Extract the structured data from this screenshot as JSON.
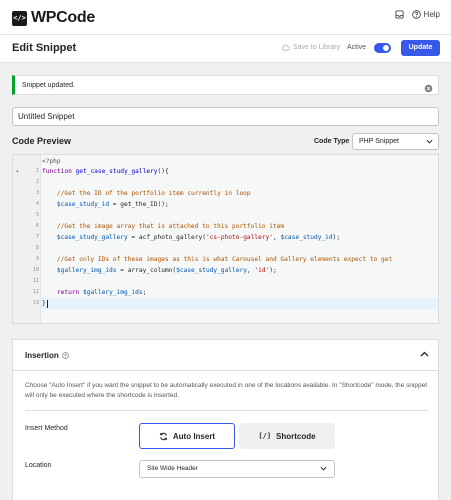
{
  "app": {
    "logo_mark": "</>",
    "logo_text": "WPCode",
    "help_label": "Help"
  },
  "header": {
    "title": "Edit Snippet",
    "save_to_library": "Save to Library",
    "active_label": "Active",
    "active": true,
    "update_label": "Update"
  },
  "notice": {
    "text": "Snippet updated."
  },
  "snippet": {
    "title_value": "Untitled Snippet"
  },
  "code_preview": {
    "title": "Code Preview",
    "code_type_label": "Code Type",
    "code_type_value": "PHP Snippet",
    "line_numbers": [
      "1",
      "2",
      "3",
      "4",
      "5",
      "6",
      "7",
      "8",
      "9",
      "10",
      "11",
      "12",
      "13"
    ],
    "header_line": "<?php",
    "lines": [
      "function get_case_study_gallery(){",
      "",
      "    //Get the ID of the portfolio item currently in loop",
      "    $case_study_id = get_the_ID();",
      "",
      "    //Get the image array that is attached to this portfolio item",
      "    $case_study_gallery = acf_photo_gallery('cs-photo-gallery', $case_study_id);",
      "",
      "    //Get only IDs of these images as this is what Carousel and Gallery elements expect to get",
      "    $gallery_img_ids = array_column($case_study_gallery, 'id');",
      "",
      "    return $gallery_img_ids;",
      "}"
    ]
  },
  "insertion": {
    "title": "Insertion",
    "description": "Choose \"Auto Insert\" if you want the snippet to be automatically executed in one of the locations available. In \"Shortcode\" mode, the snippet will only be executed where the shortcode is inserted.",
    "insert_method_label": "Insert Method",
    "auto_insert_label": "Auto Insert",
    "shortcode_glyph": "[/]",
    "shortcode_label": "Shortcode",
    "location_label": "Location",
    "location_value": "Site Wide Header"
  },
  "colors": {
    "accent": "#3858e9",
    "success": "#00a32a"
  }
}
